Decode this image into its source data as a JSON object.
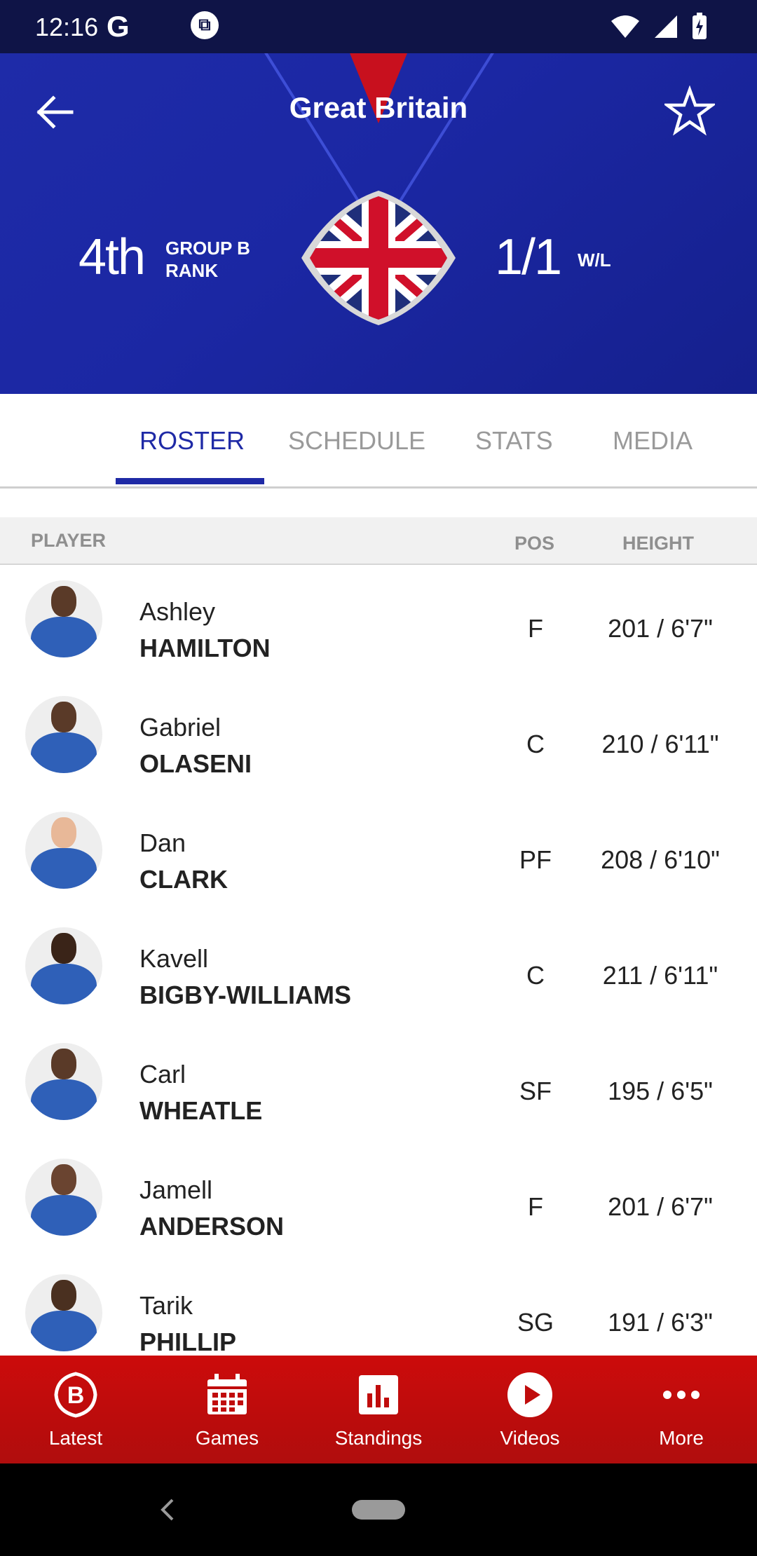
{
  "status_bar": {
    "time": "12:16",
    "g_label": "G"
  },
  "header": {
    "title": "Great Britain",
    "rank_value": "4th",
    "rank_label_line1": "GROUP B",
    "rank_label_line2": "RANK",
    "wl_value": "1/1",
    "wl_label": "W/L"
  },
  "tabs": [
    {
      "label": "ROSTER",
      "active": true
    },
    {
      "label": "SCHEDULE",
      "active": false
    },
    {
      "label": "STATS",
      "active": false
    },
    {
      "label": "MEDIA",
      "active": false
    }
  ],
  "table": {
    "col_player": "PLAYER",
    "col_pos": "POS",
    "col_height": "HEIGHT"
  },
  "players": [
    {
      "first": "Ashley",
      "last": "HAMILTON",
      "pos": "F",
      "height": "201 / 6'7\""
    },
    {
      "first": "Gabriel",
      "last": "OLASENI",
      "pos": "C",
      "height": "210 / 6'11\""
    },
    {
      "first": "Dan",
      "last": "CLARK",
      "pos": "PF",
      "height": "208 / 6'10\""
    },
    {
      "first": "Kavell",
      "last": "BIGBY-WILLIAMS",
      "pos": "C",
      "height": "211 / 6'11\""
    },
    {
      "first": "Carl",
      "last": "WHEATLE",
      "pos": "SF",
      "height": "195 / 6'5\""
    },
    {
      "first": "Jamell",
      "last": "ANDERSON",
      "pos": "F",
      "height": "201 / 6'7\""
    },
    {
      "first": "Tarik",
      "last": "PHILLIP",
      "pos": "SG",
      "height": "191 / 6'3\""
    }
  ],
  "bottom_nav": [
    {
      "label": "Latest",
      "icon": "latest-logo-icon"
    },
    {
      "label": "Games",
      "icon": "calendar-icon"
    },
    {
      "label": "Standings",
      "icon": "bar-chart-icon"
    },
    {
      "label": "Videos",
      "icon": "play-icon"
    },
    {
      "label": "More",
      "icon": "more-dots-icon"
    }
  ],
  "colors": {
    "header_blue": "#1b27a3",
    "accent_red": "#c8101e",
    "tab_active": "#1f2aa6",
    "nav_red": "#c00c0c"
  }
}
